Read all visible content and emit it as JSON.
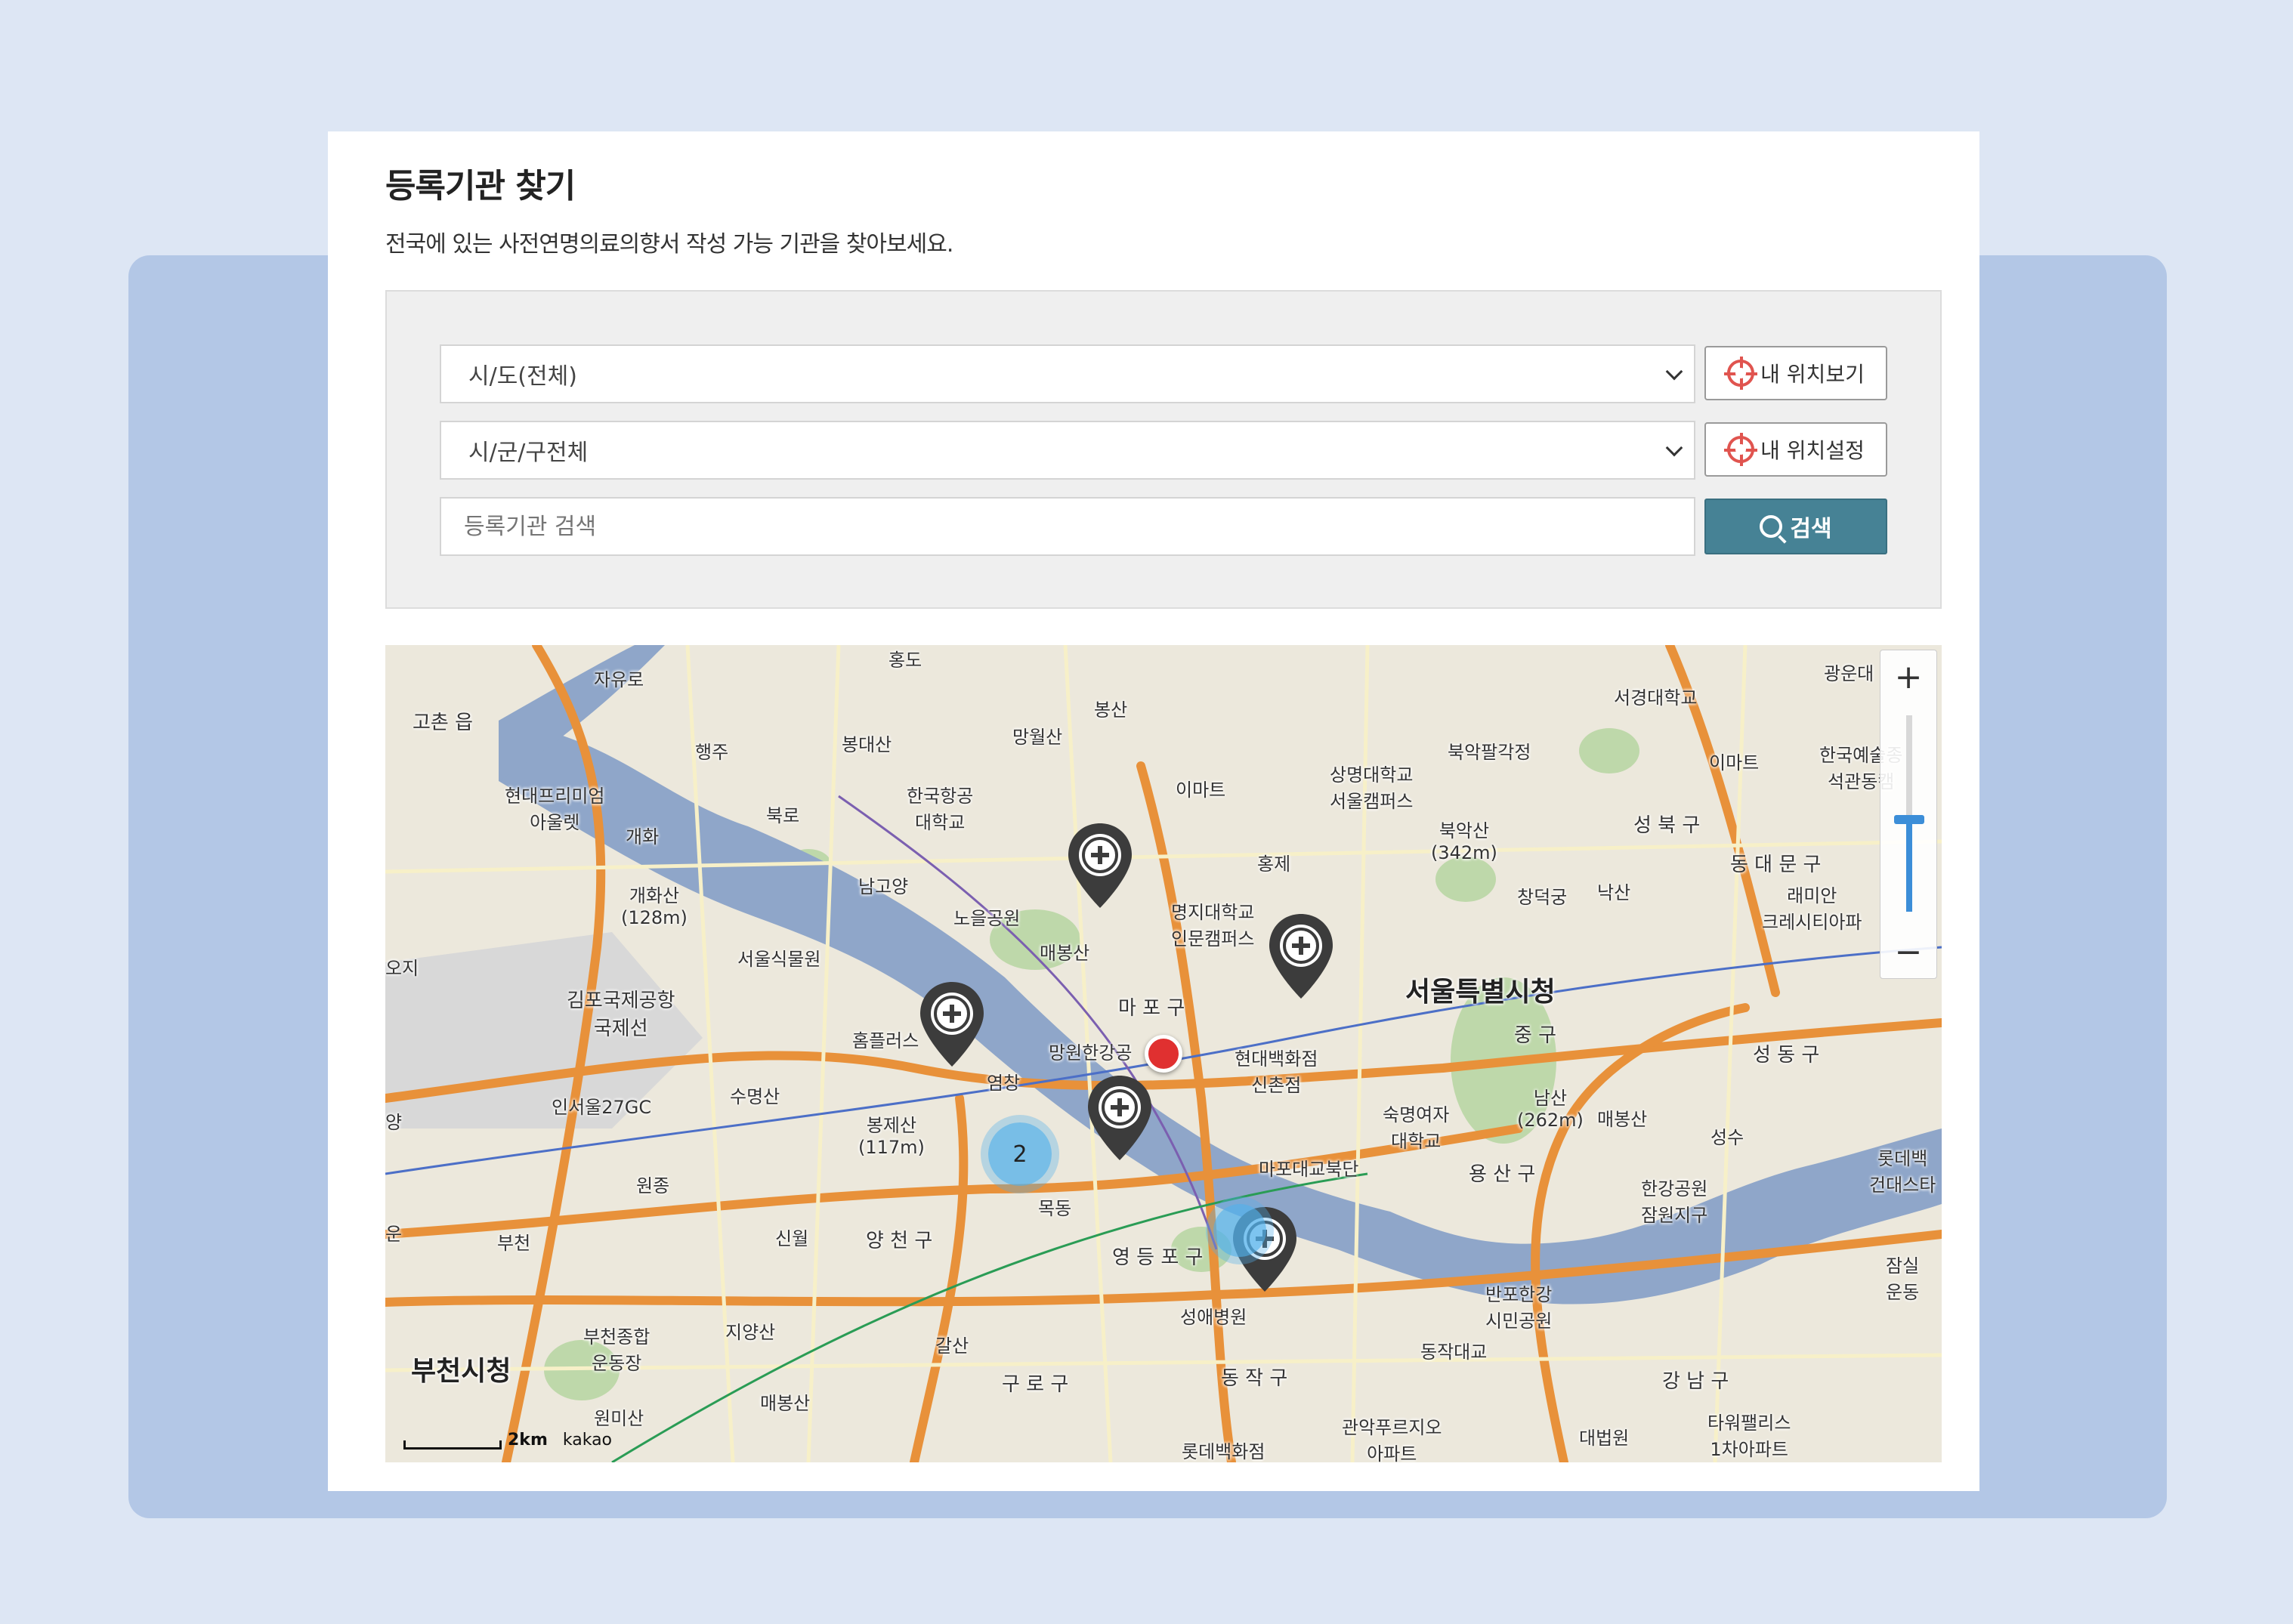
{
  "header": {
    "title": "등록기관 찾기",
    "subtitle": "전국에 있는 사전연명의료의향서 작성 가능 기관을 찾아보세요."
  },
  "search": {
    "sido_select": "시/도(전체)",
    "sigungu_select": "시/군/구전체",
    "keyword_placeholder": "등록기관 검색",
    "my_location_view_label": "내 위치보기",
    "my_location_set_label": "내 위치설정",
    "search_label": "검색"
  },
  "map": {
    "zoom_in": "+",
    "zoom_out": "−",
    "scale_text": "2km",
    "brand": "kakao",
    "cluster_count": "2",
    "labels": {
      "seoul_city_hall": "서울특별시청",
      "bucheon_city_hall": "부천시청",
      "mapo_gu": "마 포 구",
      "yangcheon_gu": "양 천 구",
      "yeongdeungpo_gu": "영 등 포 구",
      "yongsan_gu": "용 산 구",
      "dongjak_gu": "동 작 구",
      "guro_gu": "구 로 구",
      "jung_gu": "중 구",
      "seongbuk_gu": "성 북 구",
      "gangnam_gu": "강 남 구",
      "gimpo_airport": "김포국제공항\n국제선",
      "mangwon_park": "망원한강공",
      "namsan": "남산\n(262m)",
      "bukaksan": "북악산\n(342m)",
      "hyundai_sinchon": "현대백화점\n신촌점",
      "emart1": "이마트",
      "emart2": "이마트",
      "homeplus": "홈플러스",
      "sungae": "성애병원",
      "hangang_jamwon": "한강공원\n잠원지구",
      "banpo": "반포한강\n시민공원",
      "mapo_bridge": "마포대교북단",
      "bukaksan_gate": "북악팔각정",
      "seogyeong": "서경대학교",
      "mokdong": "목동",
      "sinwol": "신월",
      "bucheon": "부천",
      "gocheon": "고촌 읍",
      "haengju": "행주",
      "jayuro": "자유로",
      "hongdo": "홍도",
      "mangwolsan": "망월산",
      "bongsan": "봉산",
      "namgoyang": "남고양",
      "noeul": "노을공원",
      "maebongsan": "매봉산",
      "gaehwasan": "개화산\n(128m)",
      "seoul_botanic": "서울식물원",
      "sumyeongsan": "수명산",
      "bongjesan": "봉제산\n(117m)",
      "yeomchang": "염창",
      "wonjong": "원종",
      "jiyangsan": "지양산",
      "wonmisan": "원미산",
      "bucheon_stadium": "부천종합\n운동장",
      "gwanak_apt": "관악푸르지오\n아파트",
      "lotte_dept": "롯데백화점",
      "supreme_court": "대법원",
      "tower_palace": "타워팰리스\n1차아파트",
      "sookmyung": "숙명여자\n대학교",
      "sangmyung": "상명대학교\n서울캠퍼스",
      "myongji": "명지대학교\n인문캠퍼스",
      "changdeokgung": "창덕궁",
      "naksan": "낙산",
      "hyundai_outlet": "현대프리미엄\n아울렛",
      "hangang_aero": "한국항공\n대학교",
      "incheon_gc": "인서울27GC",
      "bongdaesan": "봉대산",
      "bukro": "북로",
      "gaehwa": "개화",
      "hongje": "홍제",
      "dongdaemun": "동 대 문 구",
      "seongdong": "성 동 구",
      "seongsu": "성수",
      "raemian": "래미안\n크레시티아파",
      "kart": "한국예술종\n석관동캠",
      "gwangun": "광운대",
      "lotte_konkuk": "롯데백\n건대스타",
      "jamsil": "잠실\n운동",
      "dongjak_bridge": "동작대교",
      "gangsan": "갈산",
      "maebong2": "매봉산",
      "maebong3": "매봉산",
      "ojee": "오지",
      "eun": "운",
      "yang": "양"
    }
  },
  "colors": {
    "accent": "#468295",
    "back_panel": "#b3c7e6",
    "page_bg": "#dde6f4",
    "river": "#8fa6c9",
    "highway": "#e8913a",
    "marker_red": "#e03030",
    "cluster_blue": "#52b0eb"
  }
}
